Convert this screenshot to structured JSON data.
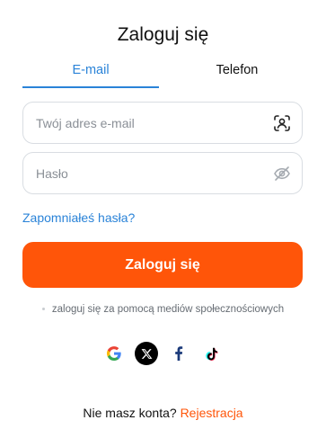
{
  "header": {
    "title": "Zaloguj się"
  },
  "tabs": [
    {
      "label": "E-mail",
      "active": true
    },
    {
      "label": "Telefon",
      "active": false
    }
  ],
  "form": {
    "email_placeholder": "Twój adres e-mail",
    "email_value": "",
    "password_placeholder": "Hasło",
    "password_value": "",
    "email_icon": "face-scan-icon",
    "password_icon": "eye-off-icon",
    "forgot_label": "Zapomniałeś hasła?",
    "submit_label": "Zaloguj się"
  },
  "social": {
    "caption": "zaloguj się za pomocą mediów społecznościowych",
    "providers": [
      "google-icon",
      "x-icon",
      "facebook-icon",
      "tiktok-icon"
    ]
  },
  "footer": {
    "question": "Nie masz konta?",
    "register_label": "Rejestracja"
  },
  "colors": {
    "accent": "#ff5509",
    "link": "#2a83d8",
    "border": "#d9dde2"
  }
}
